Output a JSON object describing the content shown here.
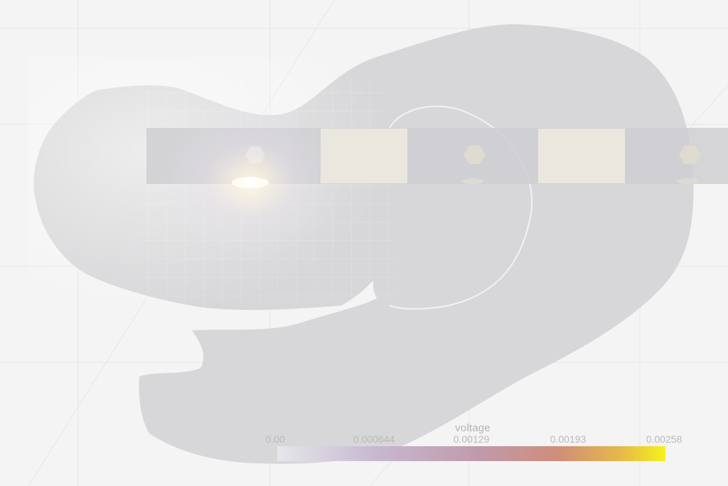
{
  "colorbar": {
    "title": "voltage",
    "ticks": [
      "0.00",
      "0.000644",
      "0.00129",
      "0.00193",
      "0.00258"
    ],
    "min": 0.0,
    "max": 0.00258,
    "colors": [
      "#f0f0f5",
      "#c7b9d0",
      "#c09aac",
      "#cf8d7a",
      "#e5b74c",
      "#f5f21a"
    ]
  },
  "colors": {
    "background": "#f4f4f5",
    "tissue": "#d7d7d9",
    "electrode": "#cfcfd2",
    "contact": "#ebe8df",
    "glow": "#fffbe8"
  }
}
